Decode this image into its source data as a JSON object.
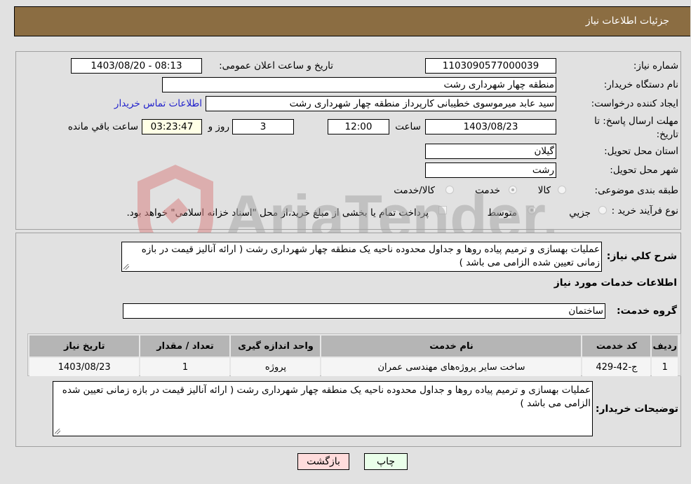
{
  "header": {
    "title": "جزئیات اطلاعات نیاز"
  },
  "fields": {
    "need_number": {
      "label": "شماره نیاز:",
      "value": "1103090577000039"
    },
    "announce_datetime": {
      "label": "تاریخ و ساعت اعلان عمومی:",
      "value": "1403/08/20 - 08:13"
    },
    "buyer_org": {
      "label": "نام دستگاه خریدار:",
      "value": "منطقه چهار شهرداری رشت"
    },
    "requester": {
      "label": "ایجاد کننده درخواست:",
      "value": "سید عابد میرموسوی خطیبانی کارپرداز منطقه چهار شهرداری رشت",
      "contact_link": "اطلاعات تماس خریدار"
    },
    "deadline": {
      "label": "مهلت ارسال پاسخ: تا تاریخ:",
      "date": "1403/08/23",
      "time_label": "ساعت",
      "time": "12:00",
      "days": "3",
      "days_label": "روز و",
      "remaining": "03:23:47",
      "remaining_label": "ساعت باقي مانده"
    },
    "province": {
      "label": "استان محل تحویل:",
      "value": "گیلان"
    },
    "city": {
      "label": "شهر محل تحویل:",
      "value": "رشت"
    },
    "category": {
      "label": "طبقه بندی موضوعی:",
      "options": [
        {
          "label": "کالا",
          "checked": false
        },
        {
          "label": "خدمت",
          "checked": true
        },
        {
          "label": "کالا/خدمت",
          "checked": false
        }
      ]
    },
    "purchase_type": {
      "label": "نوع فرآیند خرید :",
      "options": [
        {
          "label": "جزیي",
          "checked": false
        },
        {
          "label": "متوسط",
          "checked": true
        }
      ],
      "treasury_note": "پرداخت تمام یا بخشی از مبلغ خرید،از محل \"اسناد خزانه اسلامی\" خواهد بود.",
      "treasury_checked": false
    }
  },
  "description": {
    "label": "شرح کلي نیاز:",
    "value": "عملیات بهسازی و ترمیم پیاده روها و جداول محدوده ناحیه یک منطقه چهار شهرداری رشت ( ارائه آنالیز قیمت در بازه زمانی تعیین شده الزامی می باشد )"
  },
  "services_section": {
    "title": "اطلاعات خدمات مورد نیاز",
    "group_label": "گروه خدمت:",
    "group_value": "ساختمان",
    "table": {
      "headers": [
        "ردیف",
        "کد خدمت",
        "نام خدمت",
        "واحد اندازه گیری",
        "تعداد / مقدار",
        "تاریخ نیاز"
      ],
      "rows": [
        [
          "1",
          "ج-42-429",
          "ساخت سایر پروژه‌های مهندسی عمران",
          "پروژه",
          "1",
          "1403/08/23"
        ]
      ]
    }
  },
  "buyer_notes": {
    "label": "توضیحات خریدار:",
    "value": "عملیات بهسازی و ترمیم پیاده روها و جداول محدوده ناحیه یک منطقه چهار شهرداری رشت ( ارائه آنالیز قیمت در بازه زمانی تعیین شده الزامی می باشد )"
  },
  "buttons": {
    "print": "چاپ",
    "back": "بازگشت"
  },
  "watermark": {
    "text": "AriaTender.neT"
  },
  "colors": {
    "header_bg": "#8b6d42",
    "back_btn": "#ffdcdc",
    "print_btn": "#eaffea",
    "link": "#2222cc"
  }
}
